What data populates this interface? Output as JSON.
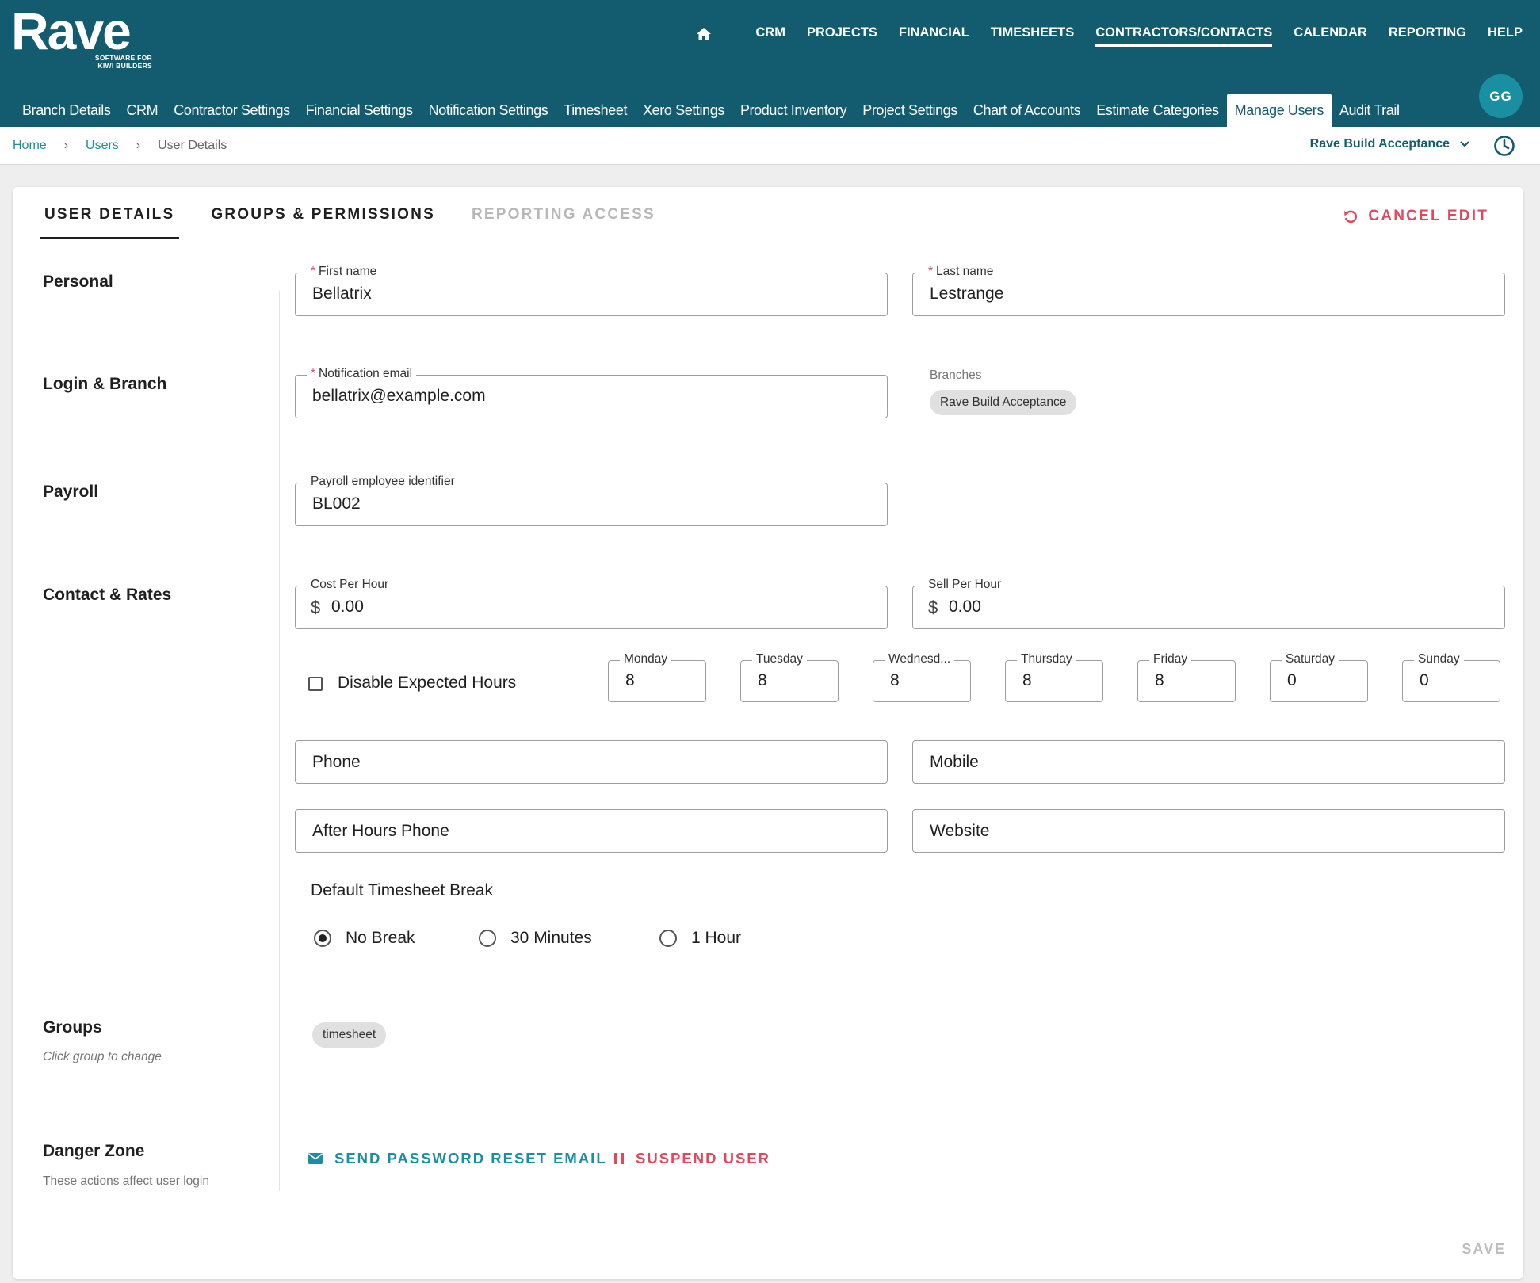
{
  "brand": {
    "name": "Rave",
    "tagline_1": "SOFTWARE FOR",
    "tagline_2": "KIWI BUILDERS"
  },
  "topnav": {
    "home_icon": "home-icon",
    "items": [
      "CRM",
      "PROJECTS",
      "FINANCIAL",
      "TIMESHEETS",
      "CONTRACTORS/CONTACTS",
      "CALENDAR",
      "REPORTING",
      "HELP"
    ],
    "active": "CONTRACTORS/CONTACTS"
  },
  "subnav": {
    "items": [
      "Branch Details",
      "CRM",
      "Contractor Settings",
      "Financial Settings",
      "Notification Settings",
      "Timesheet",
      "Xero Settings",
      "Product Inventory",
      "Project Settings",
      "Chart of Accounts",
      "Estimate Categories",
      "Manage Users",
      "Audit Trail"
    ],
    "active": "Manage Users"
  },
  "user": {
    "initials": "GG"
  },
  "breadcrumb": {
    "home": "Home",
    "users": "Users",
    "current": "User Details",
    "separator": "›"
  },
  "branch_selector": {
    "value": "Rave Build Acceptance"
  },
  "tabs": {
    "user_details": "USER DETAILS",
    "groups_permissions": "GROUPS & PERMISSIONS",
    "reporting_access": "REPORTING ACCESS"
  },
  "cancel_edit": "CANCEL EDIT",
  "sections": {
    "personal": "Personal",
    "login_branch": "Login & Branch",
    "payroll": "Payroll",
    "contact_rates": "Contact & Rates",
    "groups": "Groups",
    "groups_sub": "Click group to change",
    "danger_zone": "Danger Zone",
    "danger_sub": "These actions affect user login"
  },
  "fields": {
    "first_name": {
      "label": "First name",
      "value": "Bellatrix",
      "required": "*"
    },
    "last_name": {
      "label": "Last name",
      "value": "Lestrange",
      "required": "*"
    },
    "notification_email": {
      "label": "Notification email",
      "value": "bellatrix@example.com",
      "required": "*"
    },
    "payroll_id": {
      "label": "Payroll employee identifier",
      "value": "BL002"
    },
    "cost_per_hour": {
      "label": "Cost Per Hour",
      "currency": "$",
      "value": "0.00"
    },
    "sell_per_hour": {
      "label": "Sell Per Hour",
      "currency": "$",
      "value": "0.00"
    },
    "phone": {
      "placeholder": "Phone"
    },
    "mobile": {
      "placeholder": "Mobile"
    },
    "after_hours_phone": {
      "placeholder": "After Hours Phone"
    },
    "website": {
      "placeholder": "Website"
    }
  },
  "branches": {
    "label": "Branches",
    "chip": "Rave Build Acceptance"
  },
  "expected_hours": {
    "disable_label": "Disable Expected Hours",
    "disabled": false,
    "days": [
      {
        "label": "Monday",
        "value": "8"
      },
      {
        "label": "Tuesday",
        "value": "8"
      },
      {
        "label": "Wednesd...",
        "value": "8"
      },
      {
        "label": "Thursday",
        "value": "8"
      },
      {
        "label": "Friday",
        "value": "8"
      },
      {
        "label": "Saturday",
        "value": "0"
      },
      {
        "label": "Sunday",
        "value": "0"
      }
    ]
  },
  "timesheet_break": {
    "title": "Default Timesheet Break",
    "options": [
      "No Break",
      "30 Minutes",
      "1 Hour"
    ],
    "selected": "No Break"
  },
  "groups": {
    "chip": "timesheet"
  },
  "danger": {
    "reset": "SEND PASSWORD RESET EMAIL",
    "suspend": "SUSPEND USER"
  },
  "save": "SAVE",
  "colors": {
    "header": "#135b6e",
    "accent": "#1a8fa1",
    "danger": "#e0485e"
  }
}
